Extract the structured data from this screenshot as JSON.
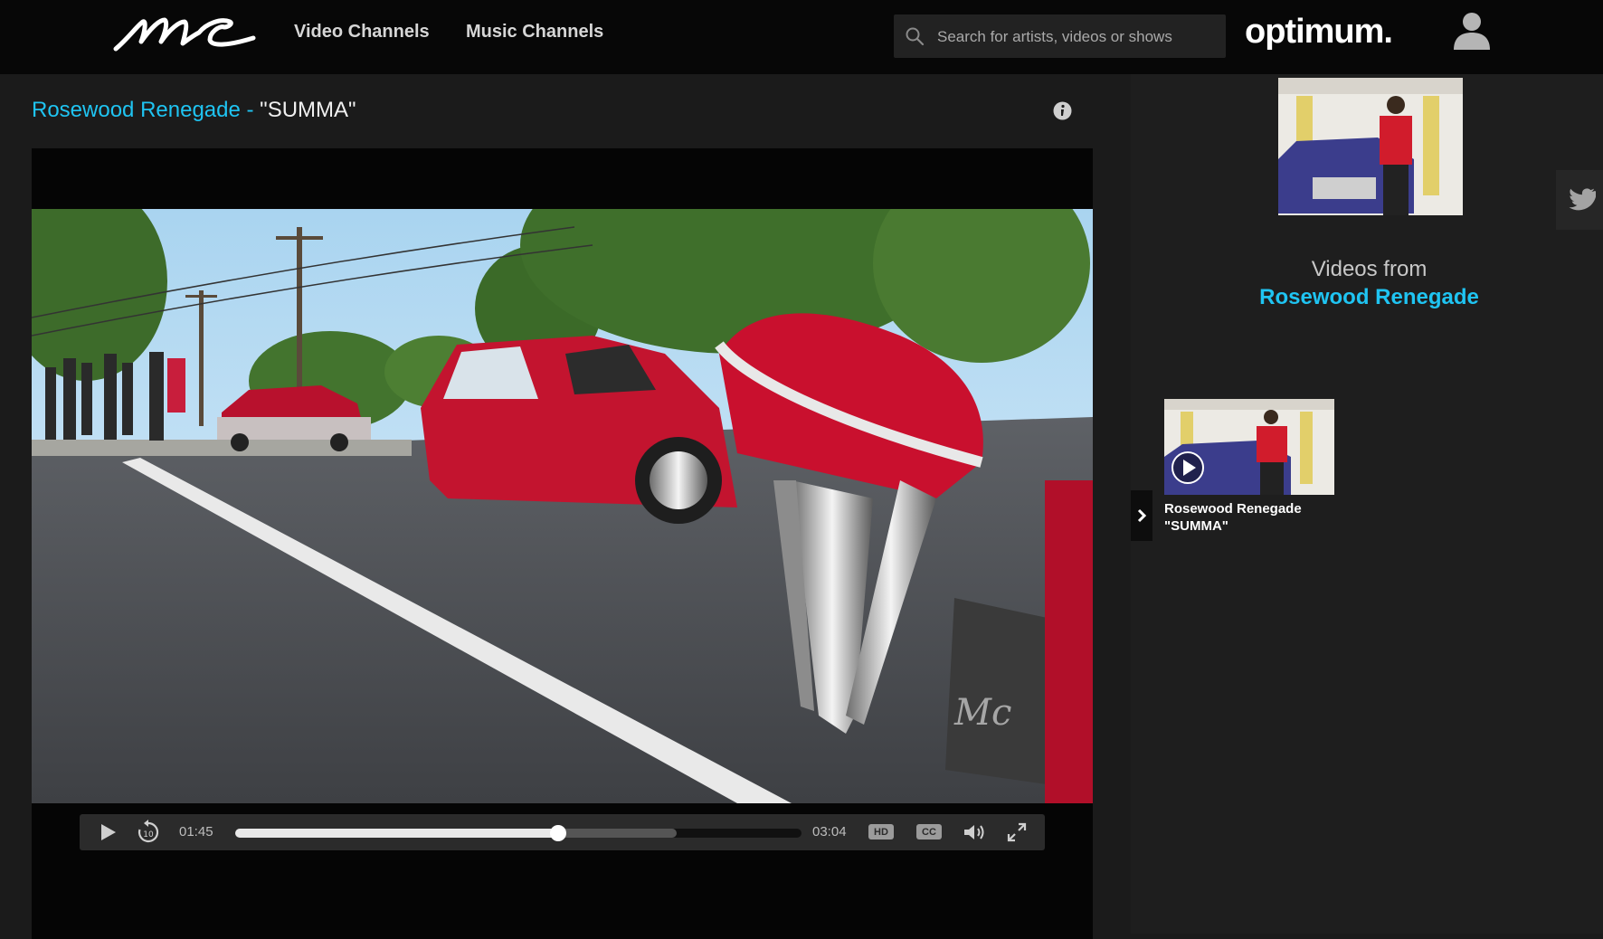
{
  "header": {
    "nav": {
      "video_channels": "Video Channels",
      "music_channels": "Music Channels"
    },
    "search": {
      "placeholder": "Search for artists, videos or shows"
    },
    "brand": "optimum."
  },
  "video": {
    "artist": "Rosewood Renegade",
    "separator": " - ",
    "title": "\"SUMMA\"",
    "player": {
      "current_time": "01:45",
      "duration": "03:04",
      "progress": 0.57,
      "buffered": 0.78,
      "hd_label": "HD",
      "cc_label": "CC"
    }
  },
  "sidebar": {
    "videos_from_label": "Videos from",
    "videos_from_artist": "Rosewood Renegade",
    "items": [
      {
        "artist": "Rosewood Renegade",
        "title": "\"SUMMA\""
      }
    ]
  },
  "colors": {
    "accent": "#1fc4f2",
    "background": "#1b1b1b",
    "header": "#070707"
  }
}
